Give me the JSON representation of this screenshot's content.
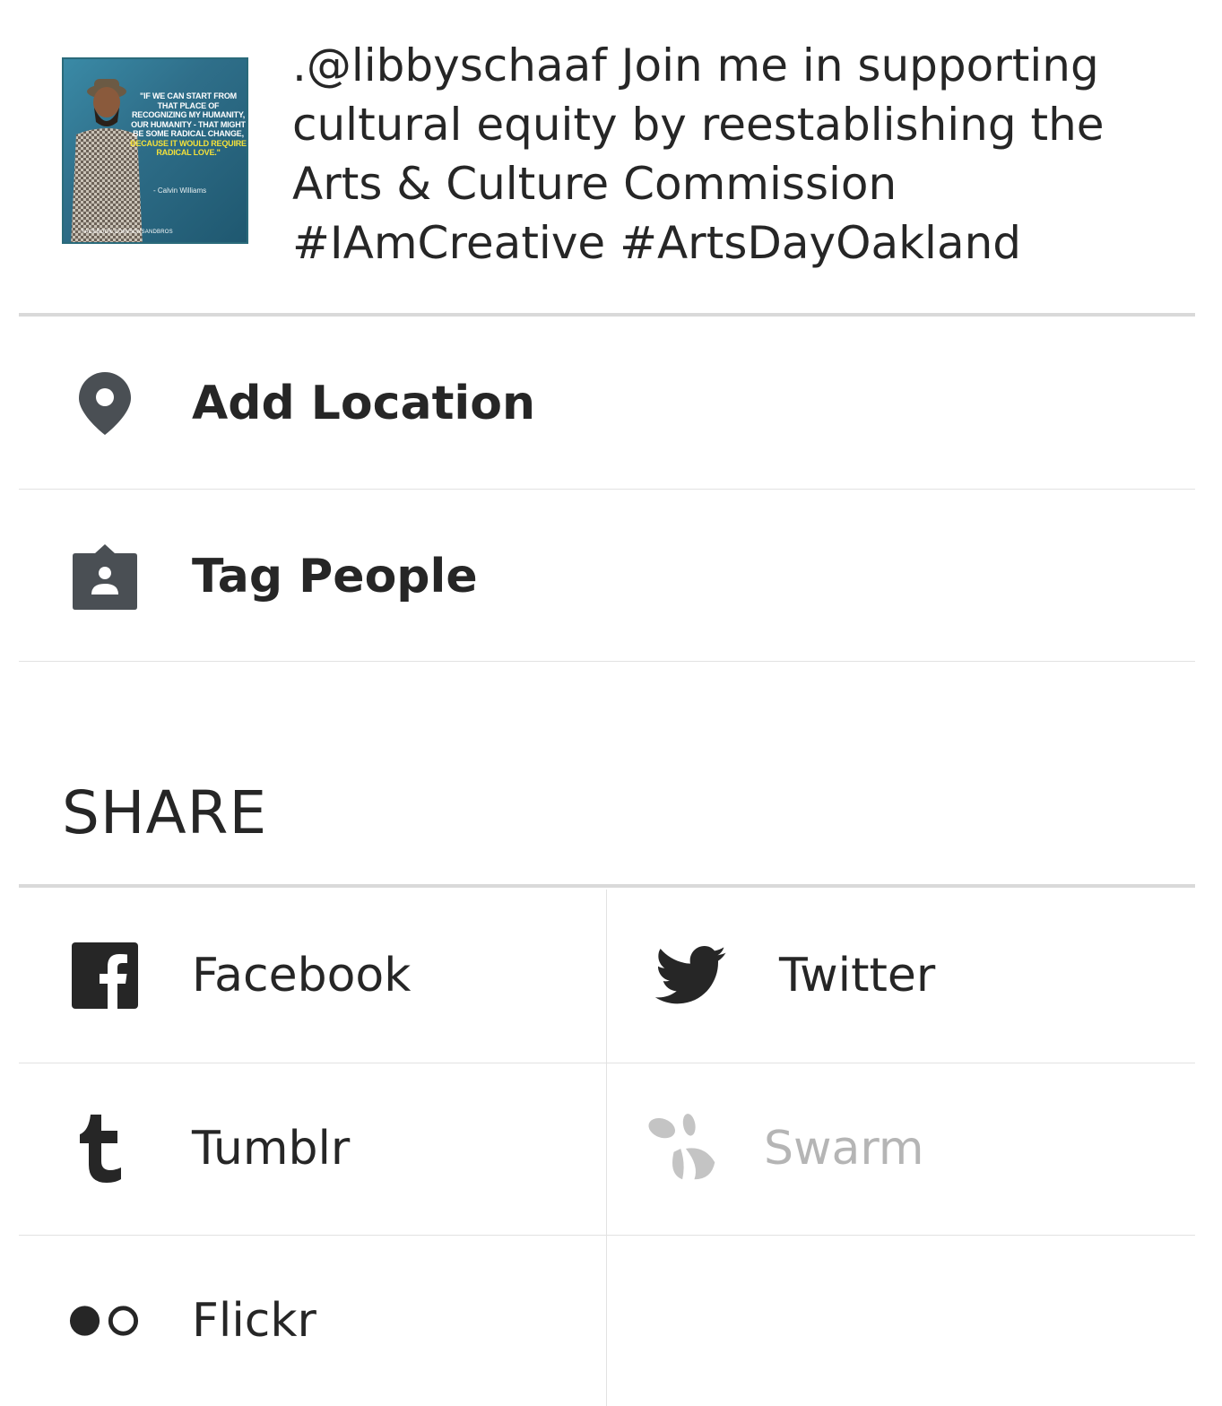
{
  "caption": {
    "text": ".@libbyschaaf Join me in supporting cultural equity by reestablishing the Arts & Culture Commission #IAmCreative #ArtsDayOakland",
    "thumbnail": {
      "quote_white": "\"If we can start from that place of recognizing my humanity, our humanity - that might be some radical change,",
      "quote_yellow": "because it would require radical love.\"",
      "author": "- Calvin Williams",
      "credit": "FACEBOOK.COM/SONSANDBROS"
    }
  },
  "options": [
    {
      "label": "Add Location",
      "icon": "map-pin-icon"
    },
    {
      "label": "Tag People",
      "icon": "tag-person-icon"
    }
  ],
  "share": {
    "heading": "SHARE",
    "targets": [
      {
        "label": "Facebook",
        "icon": "facebook-icon",
        "enabled": true
      },
      {
        "label": "Twitter",
        "icon": "twitter-icon",
        "enabled": true
      },
      {
        "label": "Tumblr",
        "icon": "tumblr-icon",
        "enabled": true
      },
      {
        "label": "Swarm",
        "icon": "swarm-icon",
        "enabled": false
      },
      {
        "label": "Flickr",
        "icon": "flickr-icon",
        "enabled": true
      }
    ]
  },
  "colors": {
    "text": "#262626",
    "icon": "#4a4f54",
    "disabled": "#b5b5b5",
    "divider": "#d9d9d9"
  }
}
